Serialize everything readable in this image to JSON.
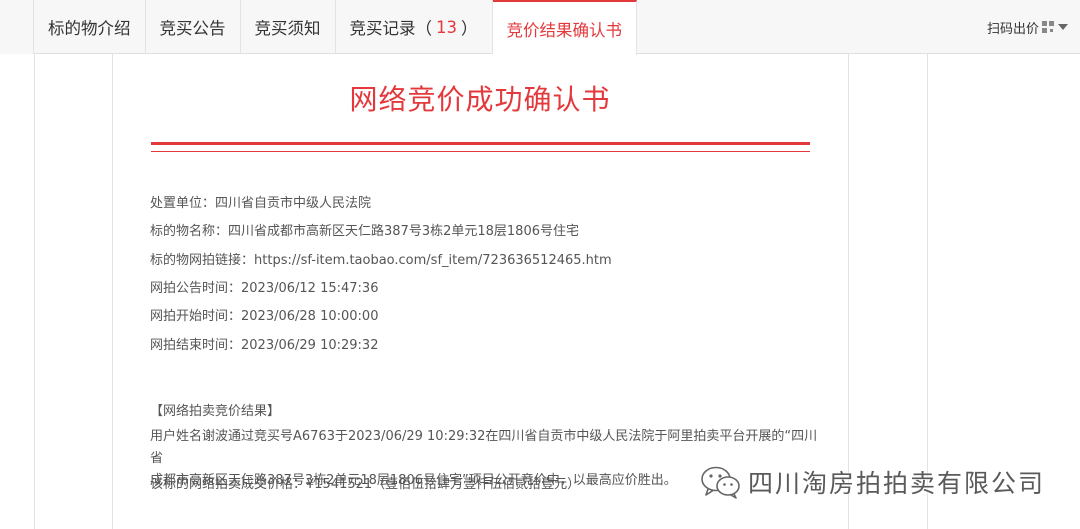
{
  "tabs": [
    {
      "label": "标的物介绍"
    },
    {
      "label": "竞买公告"
    },
    {
      "label": "竞买须知"
    },
    {
      "label": "竞买记录（",
      "count": "13",
      "suffix": "）"
    },
    {
      "label": "竞价结果确认书"
    }
  ],
  "active_tab": "竞价结果确认书",
  "scan": {
    "label": "扫码出价",
    "icon": "qr-code-icon"
  },
  "doc": {
    "title": "网络竞价成功确认书",
    "fields": [
      {
        "label": "处置单位：",
        "value": "四川省自贡市中级人民法院"
      },
      {
        "label": "标的物名称：",
        "value": "四川省成都市高新区天仁路387号3栋2单元18层1806号住宅"
      },
      {
        "label": "标的物网拍链接：",
        "value": "https://sf-item.taobao.com/sf_item/723636512465.htm"
      },
      {
        "label": "网拍公告时间：",
        "value": "2023/06/12 15:47:36"
      },
      {
        "label": "网拍开始时间：",
        "value": "2023/06/28 10:00:00"
      },
      {
        "label": "网拍结束时间：",
        "value": "2023/06/29 10:29:32"
      }
    ],
    "result_heading": "【网络拍卖竞价结果】",
    "result_line1": "用户姓名谢波通过竞买号A6763于2023/06/29 10:29:32在四川省自贡市中级人民法院于阿里拍卖平台开展的“四川省",
    "result_line2": "成都市高新区天仁路387号3栋2单元18层1806号住宅”项目公开竞价中，以最高应价胜出。",
    "price": "该标的网络拍卖成交价格：¥1541521（壹佰伍拾肆万壹仟伍佰贰拾壹元）"
  },
  "watermark": {
    "text": "四川淘房拍拍卖有限公司",
    "icon": "wechat-icon"
  },
  "colors": {
    "accent": "#e4393c",
    "tab_bg": "#f7f7f7",
    "text": "#555555"
  }
}
